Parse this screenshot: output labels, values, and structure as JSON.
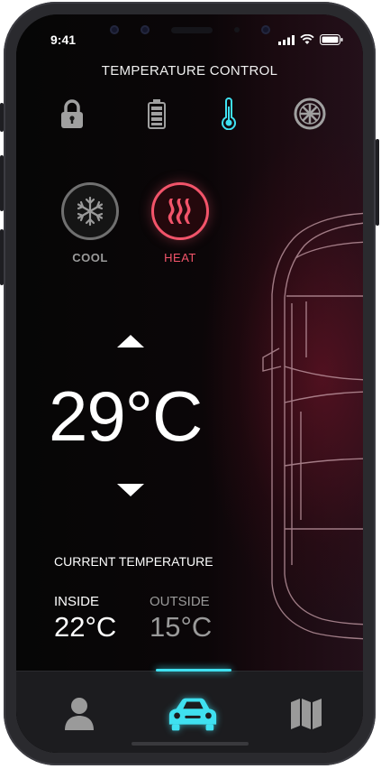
{
  "status": {
    "time": "9:41"
  },
  "header": {
    "title": "TEMPERATURE CONTROL"
  },
  "top_icons": [
    "lock-icon",
    "battery-icon",
    "thermometer-icon",
    "wheel-icon"
  ],
  "modes": {
    "cool": {
      "label": "COOL",
      "icon": "snowflake-icon"
    },
    "heat": {
      "label": "HEAT",
      "icon": "heat-waves-icon"
    }
  },
  "setpoint": {
    "value": "29°C"
  },
  "current": {
    "title": "CURRENT TEMPERATURE",
    "inside_label": "INSIDE",
    "inside_value": "22°C",
    "outside_label": "OUTSIDE",
    "outside_value": "15°C"
  },
  "tabs": [
    "profile-icon",
    "car-icon",
    "map-icon"
  ],
  "colors": {
    "accent": "#3fe0f0",
    "heat": "#f2546a",
    "muted": "#9a9a9a"
  }
}
